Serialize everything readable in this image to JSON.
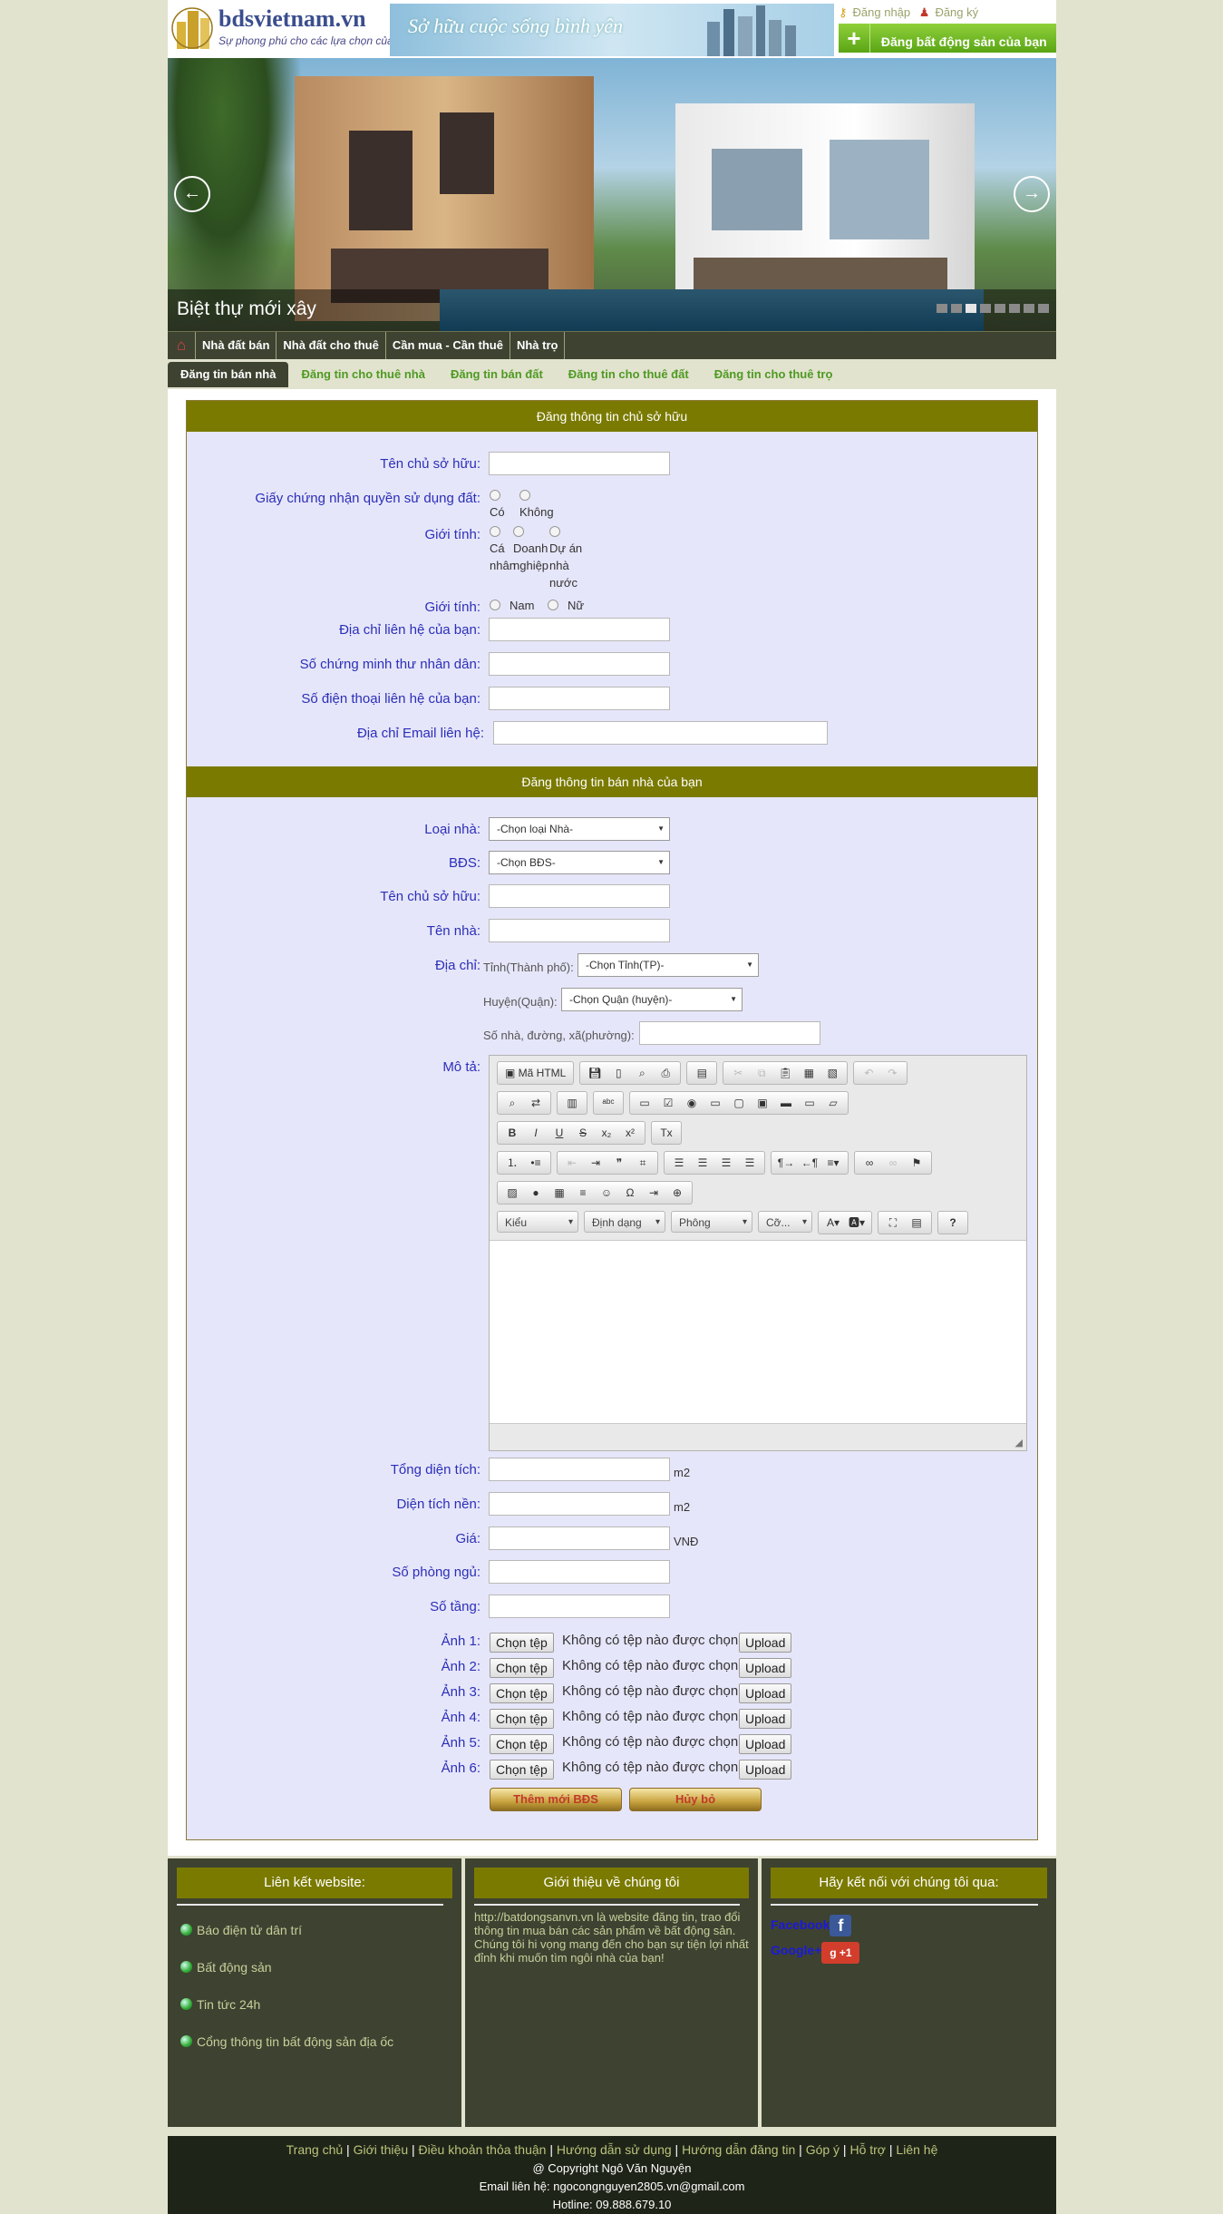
{
  "header": {
    "logo_name": "bdsvietnam.vn",
    "logo_tagline": "Sự phong phú cho các lựa chọn của bạn",
    "banner_slogan": "Sở hữu cuộc sống bình yên",
    "login_label": "Đăng nhập",
    "register_label": "Đăng ký",
    "post_button_label": "Đăng bất động sản của bạn"
  },
  "slider": {
    "caption": "Biệt thự mới xây",
    "dots_count": 8,
    "active_dot": 2
  },
  "nav": {
    "items": [
      "Nhà đất bán",
      "Nhà đất cho thuê",
      "Cần mua - Cần thuê",
      "Nhà trọ"
    ]
  },
  "tabs": {
    "items": [
      "Đăng tin bán nhà",
      "Đăng tin cho thuê nhà",
      "Đăng tin bán đất",
      "Đăng tin cho thuê đất",
      "Đăng tin cho thuê trọ"
    ],
    "active": 0
  },
  "owner_section": {
    "title": "Đăng thông tin chủ sở hữu",
    "owner_name_label": "Tên chủ sở hữu:",
    "certificate_label": "Giấy chứng nhận quyền sử dụng đất:",
    "certificate_yes": "Có",
    "certificate_no": "Không",
    "type_label": "Giới tính:",
    "type_options": [
      "Cá nhân",
      "Doanh nghiệp",
      "Dự án nhà nước"
    ],
    "gender_label": "Giới tính:",
    "gender_male": "Nam",
    "gender_female": "Nữ",
    "address_label": "Địa chỉ liên hệ của bạn:",
    "id_label": "Số chứng minh thư nhân dân:",
    "phone_label": "Số điện thoại liên hệ của bạn:",
    "email_label": "Địa chỉ Email liên hệ:"
  },
  "house_section": {
    "title": "Đăng thông tin bán nhà của bạn",
    "house_type_label": "Loại nhà:",
    "house_type_value": "-Chọn loại Nhà-",
    "bds_label": "BĐS:",
    "bds_value": "-Chọn BĐS-",
    "owner_name_label": "Tên chủ sở hữu:",
    "house_name_label": "Tên nhà:",
    "address_label": "Địa chỉ:",
    "province_label": "Tỉnh(Thành phố):",
    "province_value": "-Chọn Tỉnh(TP)-",
    "district_label": "Huyện(Quận):",
    "district_value": "-Chọn Quận (huyện)-",
    "street_label": "Số nhà, đường, xã(phường):",
    "description_label": "Mô tả:",
    "total_area_label": "Tổng diện tích:",
    "floor_area_label": "Diện tích nền:",
    "area_unit": "m2",
    "price_label": "Giá:",
    "price_unit": "VNĐ",
    "bedrooms_label": "Số phòng ngủ:",
    "floors_label": "Số tầng:",
    "photos": [
      "Ảnh 1:",
      "Ảnh 2:",
      "Ảnh 3:",
      "Ảnh 4:",
      "Ảnh 5:",
      "Ảnh 6:"
    ],
    "choose_file_label": "Chọn tệp",
    "no_file_label": "Không có tệp nào được chọn",
    "upload_label": "Upload",
    "submit_label": "Thêm mới BĐS",
    "cancel_label": "Hủy bỏ"
  },
  "editor": {
    "source_label": "Mã HTML",
    "style_combo": "Kiểu",
    "format_combo": "Định dạng",
    "font_combo": "Phông",
    "size_combo": "Cỡ...",
    "help_label": "?"
  },
  "footer": {
    "links_title": "Liên kết website:",
    "links": [
      "Báo điện tử dân trí",
      "Bất động sản",
      "Tin tức 24h",
      "Cổng thông tin bất động sản địa ốc"
    ],
    "about_title": "Giới thiệu về chúng tôi",
    "about_text": "http://batdongsanvn.vn là website đăng tin, trao đổi thông tin mua bán các sản phẩm về bất động sản. Chúng tôi hi vọng mang đến cho bạn sự tiện lợi nhất đỉnh khi muốn tìm ngôi nhà của bạn!",
    "social_title": "Hãy kết nối với chúng tôi qua:",
    "facebook_label": "Facebook",
    "google_label": "Google+",
    "google_badge": "+1",
    "bottom_links": [
      "Trang chủ",
      "Giới thiệu",
      "Điều khoản thỏa thuận",
      "Hướng dẫn sử dụng",
      "Hướng dẫn đăng tin",
      "Góp ý",
      "Hỗ trợ",
      "Liên hệ"
    ],
    "copyright": "@ Copyright Ngô Văn Nguyện",
    "email_line": "Email liên hệ: ngocongnguyen2805.vn@gmail.com",
    "hotline": "Hotline: 09.888.679.10"
  },
  "colors": {
    "section_header": "#7a7a00",
    "dark_band": "#3e4231",
    "form_bg": "#e6e6fa",
    "label_blue": "#2b2fb8",
    "tab_green": "#4e9a22"
  }
}
